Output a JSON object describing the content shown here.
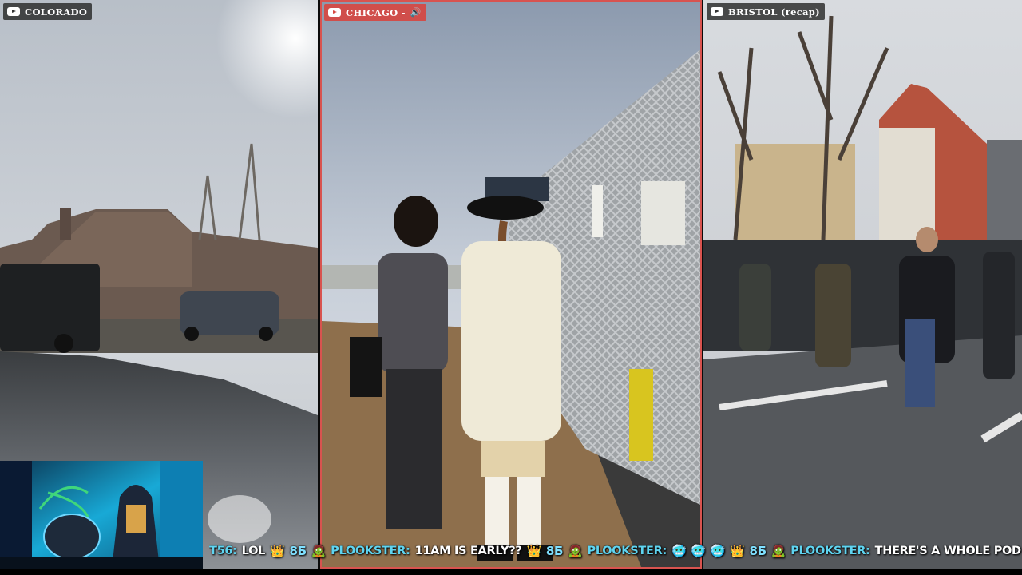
{
  "streams": [
    {
      "label": "COLORADO",
      "has_audio_icon": false
    },
    {
      "label": "CHICAGO -",
      "has_audio_icon": true,
      "audio_icon": "🔊"
    },
    {
      "label": "BRISTOL (recap)",
      "has_audio_icon": false
    }
  ],
  "chat_ticker": [
    {
      "user": "T56:",
      "text": "LOL",
      "emotes": [
        "👑",
        "8Б",
        "🧟"
      ]
    },
    {
      "user": "PLOOKSTER:",
      "text": "11AM IS EARLY??",
      "emotes": [
        "👑",
        "8Б",
        "🧟"
      ]
    },
    {
      "user": "PLOOKSTER:",
      "text": "",
      "emotes": [
        "🥶",
        "🥶",
        "🥶",
        "👑",
        "8Б",
        "🧟"
      ]
    },
    {
      "user": "PLOOKSTER:",
      "text": "THERE'S A WHOLE POD OF THEM",
      "emotes": [
        "🥶"
      ]
    }
  ],
  "colors": {
    "live_accent": "#d64842",
    "chat_user": "#5fd4f0"
  },
  "icons": [
    "youtube-icon",
    "speaker-icon"
  ]
}
